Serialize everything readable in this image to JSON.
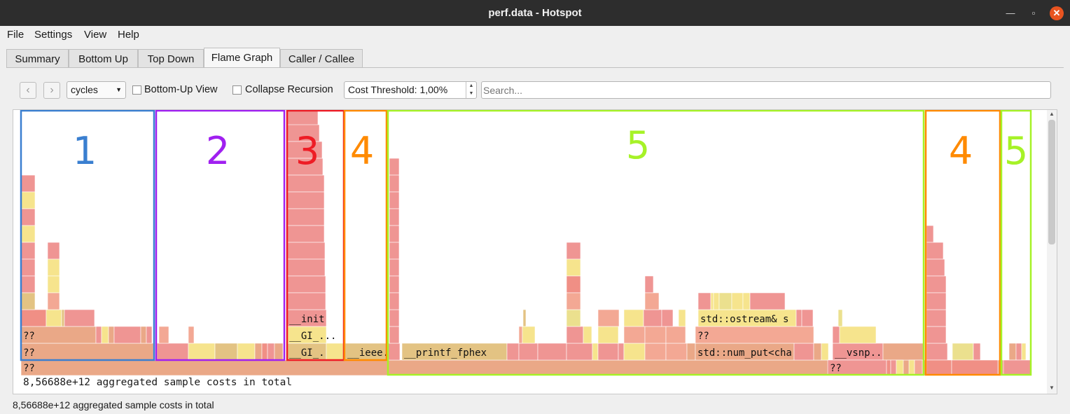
{
  "window": {
    "title": "perf.data - Hotspot"
  },
  "menu": {
    "file": "File",
    "settings": "Settings",
    "view": "View",
    "help": "Help"
  },
  "tabs": [
    {
      "label": "Summary"
    },
    {
      "label": "Bottom Up"
    },
    {
      "label": "Top Down"
    },
    {
      "label": "Flame Graph",
      "active": true
    },
    {
      "label": "Caller / Callee"
    }
  ],
  "toolbar": {
    "back_icon": "chevron-left-icon",
    "forward_icon": "chevron-right-icon",
    "event_type": "cycles",
    "bottom_up_label": "Bottom-Up View",
    "collapse_recursion_label": "Collapse Recursion",
    "cost_threshold": "Cost Threshold: 1,00%",
    "search_placeholder": "Search..."
  },
  "flame_labels": {
    "root": "??",
    "col1_l2": "??",
    "col1_l3": "??",
    "init": "__init",
    "gi_1": "__GI_...",
    "gi_2": "__GI_...",
    "ieee": "__ieee...",
    "printf": "__printf_fphex",
    "ostream": "std::ostream& s",
    "num_put": "std::num_put<cha",
    "qq_mid": "??",
    "vsnp": "__vsnp...",
    "qq_right": "??"
  },
  "annotations": [
    {
      "label": "1",
      "color": "#3a7fd0"
    },
    {
      "label": "2",
      "color": "#a020f0"
    },
    {
      "label": "3",
      "color": "#ee1c25"
    },
    {
      "label": "4",
      "color": "#ff8a00"
    },
    {
      "label": "5",
      "color": "#a6f227"
    },
    {
      "label": "4",
      "color": "#ff8a00"
    },
    {
      "label": "5",
      "color": "#a6f227"
    }
  ],
  "status": {
    "inner": "8,56688e+12 aggregated sample costs in total",
    "bottom": "8,56688e+12 aggregated sample costs in total"
  },
  "colors": {
    "titlebar": "#2d2d2d",
    "close_button": "#e95420"
  }
}
